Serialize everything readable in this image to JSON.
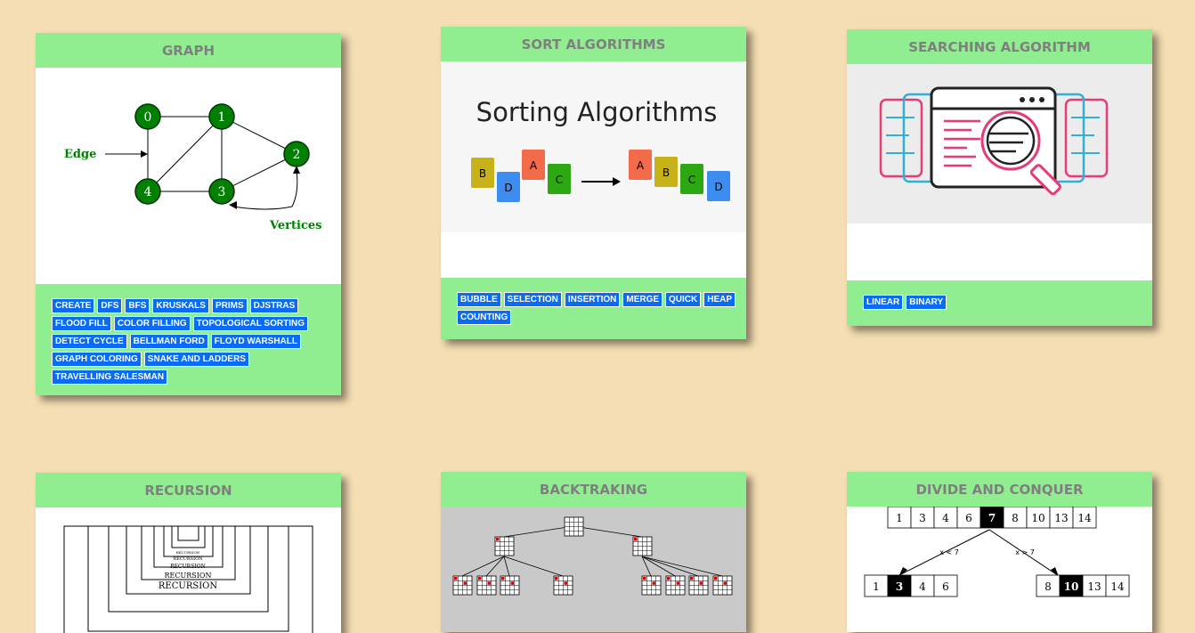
{
  "cards": {
    "graph": {
      "title": "GRAPH",
      "image": {
        "edge_label": "Edge",
        "vertices_label": "Vertices",
        "nodes": [
          "0",
          "1",
          "2",
          "3",
          "4"
        ]
      },
      "buttons": [
        "CREATE",
        "DFS",
        "BFS",
        "KRUSKALS",
        "PRIMS",
        "DJSTRAS",
        "FLOOD FILL",
        "COLOR FILLING",
        "TOPOLOGICAL SORTING",
        "DETECT CYCLE",
        "BELLMAN FORD",
        "FLOYD WARSHALL",
        "GRAPH COLORING",
        "SNAKE AND LADDERS",
        "TRAVELLING SALESMAN"
      ]
    },
    "sort": {
      "title": "SORT ALGORITHMS",
      "image": {
        "heading": "Sorting Algorithms",
        "before": [
          "B",
          "D",
          "A",
          "C"
        ],
        "after": [
          "A",
          "B",
          "C",
          "D"
        ]
      },
      "buttons": [
        "BUBBLE",
        "SELECTION",
        "INSERTION",
        "MERGE",
        "QUICK",
        "HEAP",
        "COUNTING"
      ]
    },
    "search": {
      "title": "SEARCHING ALGORITHM",
      "buttons": [
        "LINEAR",
        "BINARY"
      ]
    },
    "recursion": {
      "title": "RECURSION",
      "image": {
        "word": "RECURSION"
      }
    },
    "backtracking": {
      "title": "BACKTRAKING"
    },
    "divide": {
      "title": "DIVIDE AND CONQUER",
      "image": {
        "top_row": [
          "1",
          "3",
          "4",
          "6",
          "7",
          "8",
          "10",
          "13",
          "14"
        ],
        "left_label": "x < 7",
        "right_label": "x > 7",
        "left_row": [
          "1",
          "3",
          "4",
          "6"
        ],
        "right_row": [
          "8",
          "10",
          "13",
          "14"
        ]
      }
    }
  },
  "colors": {
    "page_bg": "#f5deb3",
    "header_bg": "#90ee90",
    "button_bg": "#0a6cf5",
    "node_green": "#008000"
  }
}
